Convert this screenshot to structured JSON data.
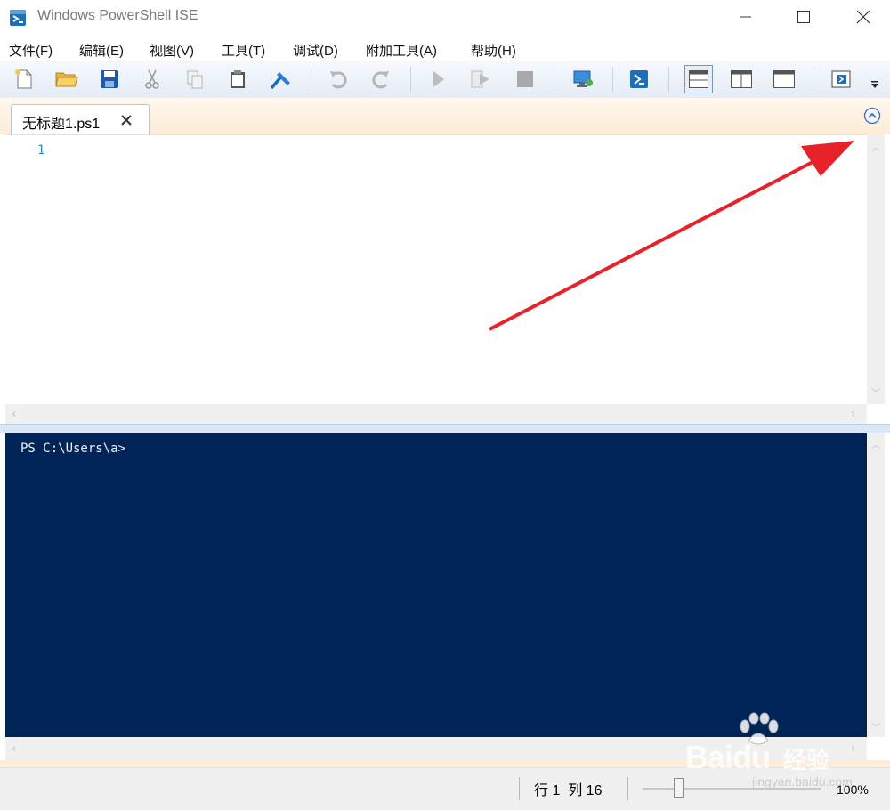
{
  "window": {
    "title": "Windows PowerShell ISE",
    "icons": {
      "app": "powershell-ise-icon",
      "minimize": "minimize-icon",
      "maximize": "maximize-icon",
      "close": "close-icon"
    }
  },
  "menu": {
    "items": [
      "文件(F)",
      "编辑(E)",
      "视图(V)",
      "工具(T)",
      "调试(D)",
      "附加工具(A)",
      "帮助(H)"
    ]
  },
  "toolbar": {
    "buttons": [
      "new-icon",
      "open-icon",
      "save-icon",
      "cut-icon",
      "copy-icon",
      "paste-icon",
      "clear-console-icon",
      "undo-icon",
      "redo-icon",
      "run-icon",
      "run-selection-icon",
      "stop-icon",
      "remote-powershell-icon",
      "powershell-icon",
      "show-script-top-icon",
      "show-script-right-icon",
      "show-script-maximized-icon",
      "show-command-addon-icon",
      "toolbar-overflow-icon"
    ]
  },
  "tabs": [
    {
      "label": "无标题1.ps1",
      "close_icon": "close-icon"
    }
  ],
  "editor": {
    "line_numbers": [
      "1"
    ],
    "content": ""
  },
  "console": {
    "prompt": "PS C:\\Users\\a>"
  },
  "statusbar": {
    "position": "行 1  列 16",
    "zoom": "100%",
    "zoom_level_percent": 100
  },
  "watermark": {
    "brand": "Bai",
    "brand2": "du",
    "jingyan": "经验",
    "url": "jingyan.baidu.com"
  },
  "colors": {
    "console_bg": "#012456",
    "console_text": "#eeedf0",
    "line_number": "#2b91af",
    "annotation_arrow": "#e8222b"
  }
}
